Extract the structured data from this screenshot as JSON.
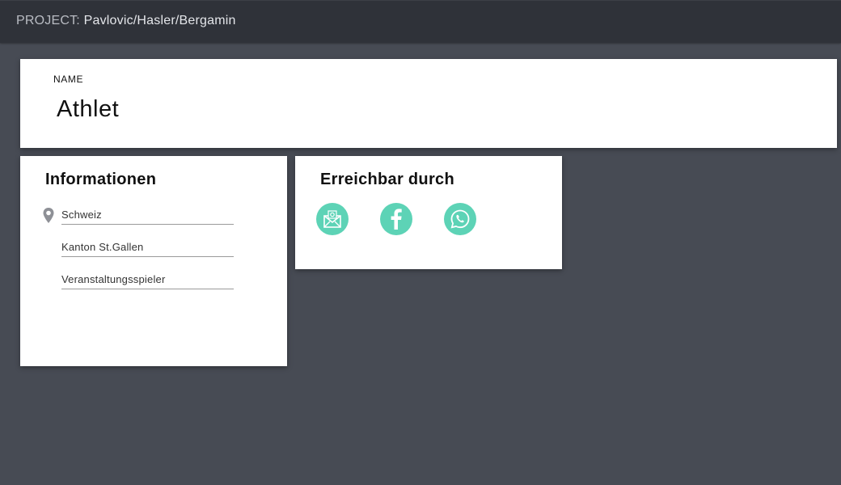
{
  "header": {
    "project_label": "PROJECT:",
    "project_value": "Pavlovic/Hasler/Bergamin"
  },
  "name_card": {
    "label": "NAME",
    "value": "Athlet"
  },
  "info_card": {
    "title": "Informationen",
    "fields": [
      {
        "value": "Schweiz",
        "icon": "location-pin-icon"
      },
      {
        "value": "Kanton St.Gallen"
      },
      {
        "value": "Veranstaltungsspieler"
      }
    ]
  },
  "contact_card": {
    "title": "Erreichbar durch",
    "icons": [
      "email-icon",
      "facebook-icon",
      "whatsapp-icon"
    ],
    "accent": "#5dd3b6"
  },
  "colors": {
    "background": "#474b54",
    "topbar": "#2f3239",
    "card": "#ffffff"
  }
}
